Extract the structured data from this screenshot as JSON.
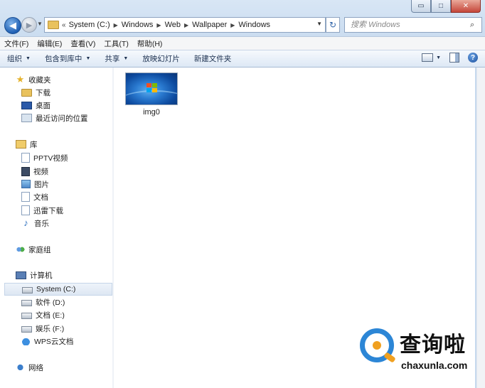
{
  "window": {
    "caption_min": "▭",
    "caption_max": "□",
    "caption_close": "✕"
  },
  "navigation": {
    "back_glyph": "◀",
    "forward_glyph": "▶",
    "history_glyph": "▼",
    "address_prefix": "«",
    "breadcrumbs": [
      "System (C:)",
      "Windows",
      "Web",
      "Wallpaper",
      "Windows"
    ],
    "crumb_separator": "▶",
    "address_dropdown": "▼",
    "refresh_glyph": "↻",
    "search_placeholder": "搜索 Windows",
    "search_glyph": "⌕"
  },
  "menubar": {
    "items": [
      "文件(F)",
      "编辑(E)",
      "查看(V)",
      "工具(T)",
      "帮助(H)"
    ]
  },
  "toolbar": {
    "organize": "组织",
    "include_in_library": "包含到库中",
    "share": "共享",
    "slideshow": "放映幻灯片",
    "new_folder": "新建文件夹",
    "dropdown_glyph": "▼",
    "help_glyph": "?"
  },
  "sidebar": {
    "favorites": {
      "label": "收藏夹",
      "items": [
        "下载",
        "桌面",
        "最近访问的位置"
      ]
    },
    "libraries": {
      "label": "库",
      "items": [
        "PPTV视频",
        "视频",
        "图片",
        "文档",
        "迅雷下载",
        "音乐"
      ]
    },
    "homegroup": {
      "label": "家庭组"
    },
    "computer": {
      "label": "计算机",
      "items": [
        "System (C:)",
        "软件 (D:)",
        "文档 (E:)",
        "娱乐 (F:)",
        "WPS云文档"
      ]
    },
    "network": {
      "label": "网络"
    }
  },
  "files": [
    {
      "name": "img0"
    }
  ],
  "watermark": {
    "chinese": "查询啦",
    "domain": "chaxunla.com"
  }
}
